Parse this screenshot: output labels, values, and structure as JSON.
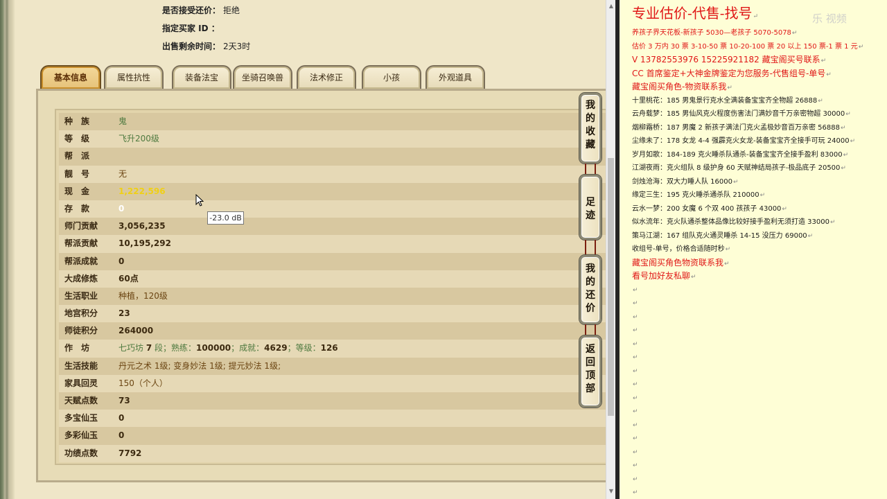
{
  "meta": {
    "accept_offer_label": "是否接受还价：",
    "accept_offer_value": "拒绝",
    "buyer_id_label": "指定买家 ID ：",
    "buyer_id_value": "",
    "time_left_label": "出售剩余时间：",
    "time_left_value": "2天3时"
  },
  "tabs": [
    "基本信息",
    "属性抗性",
    "装备法宝",
    "坐骑召唤兽",
    "法术修正",
    "小孩",
    "外观道具"
  ],
  "active_tab": "基本信息",
  "info": [
    {
      "label": "种　族",
      "value": "鬼"
    },
    {
      "label": "等　级",
      "value": "飞升200级"
    },
    {
      "label": "帮　派",
      "value": ""
    },
    {
      "label": "靓　号",
      "value": "无"
    },
    {
      "label": "现　金",
      "value": "1,222,596"
    },
    {
      "label": "存　款",
      "value": "0"
    },
    {
      "label": "师门贡献",
      "value": "3,056,235"
    },
    {
      "label": "帮派贡献",
      "value": "10,195,292"
    },
    {
      "label": "帮派成就",
      "value": "0"
    },
    {
      "label": "大成修炼",
      "value": "60点"
    },
    {
      "label": "生活职业",
      "value": "种植，120级"
    },
    {
      "label": "地宫积分",
      "value": "23"
    },
    {
      "label": "师徒积分",
      "value": "264000"
    },
    {
      "label": "作　坊",
      "value": ""
    },
    {
      "label": "生活技能",
      "value": "丹元之术 1级; 变身妙法 1级; 提元妙法 1级;"
    },
    {
      "label": "家具回灵",
      "value": "150（个人）"
    },
    {
      "label": "天赋点数",
      "value": "73"
    },
    {
      "label": "多宝仙玉",
      "value": "0"
    },
    {
      "label": "多彩仙玉",
      "value": "0"
    },
    {
      "label": "功绩点数",
      "value": "7792"
    }
  ],
  "workshop": {
    "name": "七巧坊",
    "level": "7",
    "level_unit": "段；熟练：",
    "skill": "100000",
    "achieve_label": "；成就：",
    "achieve": "4629",
    "grade_label": "；等级：",
    "grade": "126"
  },
  "side_buttons": [
    "我的收藏",
    "足迹",
    "我的还价",
    "返回顶部"
  ],
  "tooltip": "-23.0 dB",
  "notes": {
    "title": "专业估价-代售-找号",
    "lines": [
      {
        "text": "养孩子界天花板-新孩子 5030—老孩子 5070-5078",
        "style": "red"
      },
      {
        "text": "估价 3 万内 30 票  3-10-50 票  10-20-100 票  20 以上 150 票-1 票 1 元",
        "style": "red"
      },
      {
        "text": "V  13782553976    15225921182   藏宝阁买号联系",
        "style": "red big"
      },
      {
        "text": "CC 首席鉴定+大神金牌鉴定为您服务-代售组号-单号",
        "style": "red big"
      },
      {
        "text": "藏宝阁买角色-物资联系我",
        "style": "red big"
      },
      {
        "text": "十里桃花：185 男鬼景行克水全满装备宝宝齐全物超 26888",
        "style": ""
      },
      {
        "text": "云舟载梦：185 男仙风克火程度伤害法门满妙音千万亲密物超 30000",
        "style": ""
      },
      {
        "text": "烟柳霜桥：187 男魔 2 新孩子满法门克火孟极妙音百万亲密 56888",
        "style": ""
      },
      {
        "text": "尘缘未了：178 女龙 4-4 强霹克火女龙-装备宝宝齐全接手可玩 24000",
        "style": ""
      },
      {
        "text": "岁月如歌：184-189 克火睡杀队通杀-装备宝宝齐全接手盈利 83000",
        "style": ""
      },
      {
        "text": "江湖夜雨：克火组队 8 级护身 60 天赋神结局孩子-极品底子 20500",
        "style": ""
      },
      {
        "text": "剑烛沧海：双大力睡人队 16000",
        "style": ""
      },
      {
        "text": "缘定三生：195 克火睡杀通杀队 210000",
        "style": ""
      },
      {
        "text": "云水一梦：200 女魔 6 个双 400 孩孩子 43000",
        "style": ""
      },
      {
        "text": "似水流年：克火队通杀整体品像比较好接手盈利无须打造 33000",
        "style": ""
      },
      {
        "text": "策马江湖：167 组队克火通灵睡杀 14-15 没压力 69000",
        "style": ""
      },
      {
        "text": "收组号-单号，价格合适随时秒",
        "style": ""
      },
      {
        "text": "藏宝阁买角色物资联系我",
        "style": "red big"
      },
      {
        "text": "看号加好友私聊",
        "style": "red big"
      }
    ],
    "empty_lines": 17
  },
  "watermark": "乐 视频",
  "colors": {
    "accent_red": "#e01616",
    "panel_bg": "#efe6c8",
    "notes_bg": "#fefed6",
    "cash_yellow": "#f0d015",
    "green_text": "#4f7a40"
  }
}
